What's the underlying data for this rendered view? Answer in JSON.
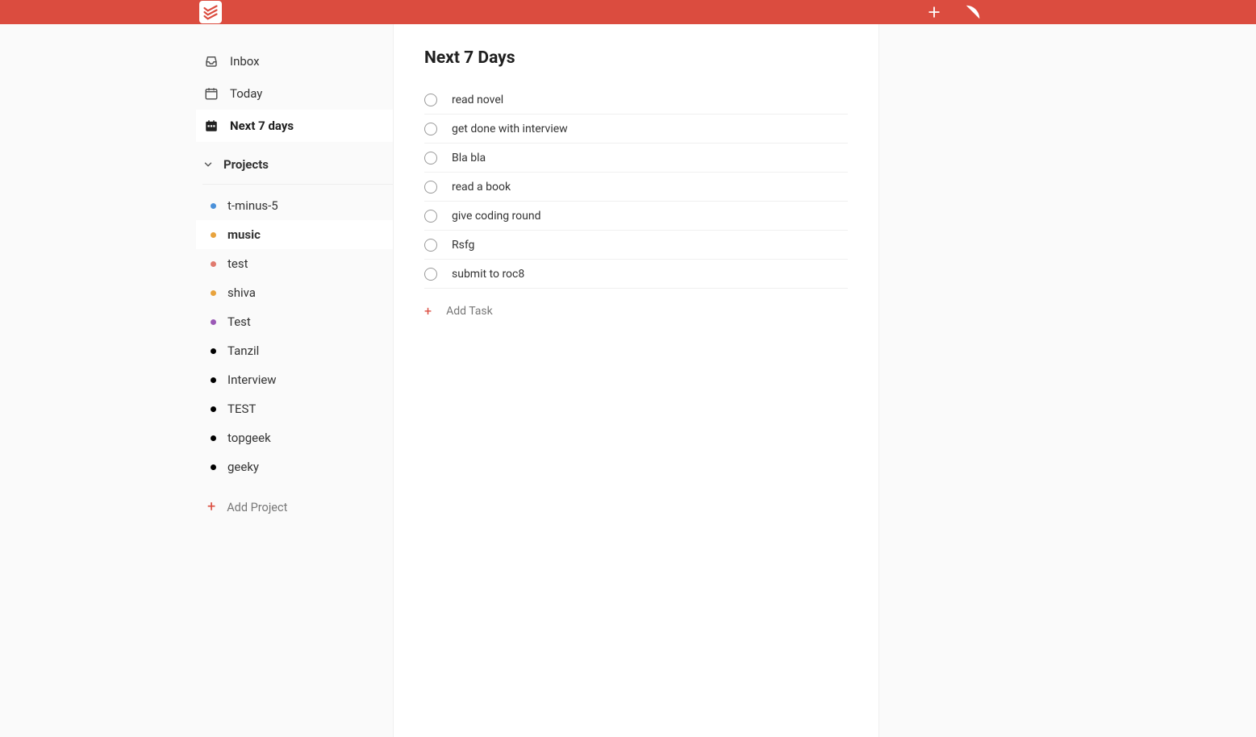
{
  "header": {
    "add_icon": "plus",
    "pizza_icon": "pizza"
  },
  "sidebar": {
    "filters": [
      {
        "key": "inbox",
        "label": "Inbox",
        "active": false
      },
      {
        "key": "today",
        "label": "Today",
        "active": false
      },
      {
        "key": "next7",
        "label": "Next 7 days",
        "active": true
      }
    ],
    "projects_header": "Projects",
    "projects": [
      {
        "label": "t-minus-5",
        "color": "#4a90d9",
        "hover": false
      },
      {
        "label": "music",
        "color": "#e8a33d",
        "hover": true
      },
      {
        "label": "test",
        "color": "#e07a6e",
        "hover": false
      },
      {
        "label": "shiva",
        "color": "#e8a33d",
        "hover": false
      },
      {
        "label": "Test",
        "color": "#9b59b6",
        "hover": false
      },
      {
        "label": "Tanzil",
        "color": "#000000",
        "hover": false
      },
      {
        "label": "Interview",
        "color": "#000000",
        "hover": false
      },
      {
        "label": "TEST",
        "color": "#000000",
        "hover": false
      },
      {
        "label": "topgeek",
        "color": "#000000",
        "hover": false
      },
      {
        "label": "geeky",
        "color": "#000000",
        "hover": false
      }
    ],
    "add_project_label": "Add Project"
  },
  "main": {
    "title": "Next 7 Days",
    "tasks": [
      {
        "label": "read novel"
      },
      {
        "label": "get done with interview"
      },
      {
        "label": "Bla bla"
      },
      {
        "label": "read a book"
      },
      {
        "label": "give coding round"
      },
      {
        "label": "Rsfg"
      },
      {
        "label": "submit to roc8"
      }
    ],
    "add_task_label": "Add Task"
  }
}
